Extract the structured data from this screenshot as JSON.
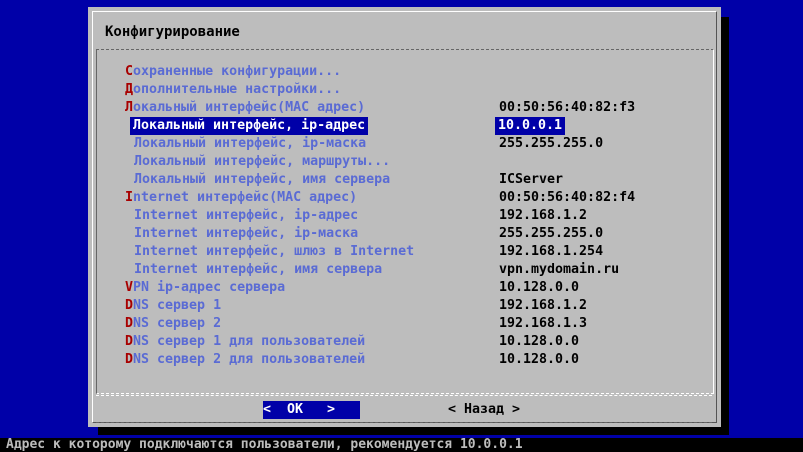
{
  "dialog": {
    "title": "Конфигурирование",
    "items": [
      {
        "hotkey": "С",
        "label": "охраненные конфигурации...",
        "value": "",
        "indent": false,
        "selected": false
      },
      {
        "hotkey": "Д",
        "label": "ополнительные настройки...",
        "value": "",
        "indent": false,
        "selected": false
      },
      {
        "hotkey": "Л",
        "label": "окальный интерфейс(MAC адрес)",
        "value": "00:50:56:40:82:f3",
        "indent": false,
        "selected": false
      },
      {
        "hotkey": "",
        "label": "Локальный интерфейс, ip-адрес",
        "value": "10.0.0.1",
        "indent": true,
        "selected": true
      },
      {
        "hotkey": "",
        "label": "Локальный интерфейс, ip-маска",
        "value": "255.255.255.0",
        "indent": true,
        "selected": false
      },
      {
        "hotkey": "",
        "label": "Локальный интерфейс, маршруты...",
        "value": "",
        "indent": true,
        "selected": false
      },
      {
        "hotkey": "",
        "label": "Локальный интерфейс, имя сервера",
        "value": "ICServer",
        "indent": true,
        "selected": false
      },
      {
        "hotkey": "I",
        "label": "nternet интерфейс(MAC адрес)",
        "value": "00:50:56:40:82:f4",
        "indent": false,
        "selected": false
      },
      {
        "hotkey": "",
        "label": "Internet интерфейс, ip-адрес",
        "value": "192.168.1.2",
        "indent": true,
        "selected": false
      },
      {
        "hotkey": "",
        "label": "Internet интерфейс, ip-маска",
        "value": "255.255.255.0",
        "indent": true,
        "selected": false
      },
      {
        "hotkey": "",
        "label": "Internet интерфейс, шлюз в Internet",
        "value": "192.168.1.254",
        "indent": true,
        "selected": false
      },
      {
        "hotkey": "",
        "label": "Internet интерфейс, имя сервера",
        "value": "vpn.mydomain.ru",
        "indent": true,
        "selected": false
      },
      {
        "hotkey": "V",
        "label": "PN ip-адрес сервера",
        "value": "10.128.0.0",
        "indent": false,
        "selected": false
      },
      {
        "hotkey": "D",
        "label": "NS сервер 1",
        "value": "192.168.1.2",
        "indent": false,
        "selected": false
      },
      {
        "hotkey": "D",
        "label": "NS сервер 2",
        "value": "192.168.1.3",
        "indent": false,
        "selected": false
      },
      {
        "hotkey": "D",
        "label": "NS сервер 1 для пользователей",
        "value": "10.128.0.0",
        "indent": false,
        "selected": false
      },
      {
        "hotkey": "D",
        "label": "NS сервер 2 для пользователей",
        "value": "10.128.0.0",
        "indent": false,
        "selected": false
      }
    ]
  },
  "buttons": {
    "ok": "<  OK   >",
    "back": "< Назад >"
  },
  "status_bar": "Адрес к которому подключаются пользователи, рекомендуется 10.0.0.1",
  "colors": {
    "background": "#0000a8",
    "dialog": "#bdbdbd",
    "hotkey": "#a80000",
    "label": "#5a6bd4",
    "selection": "#0000a8"
  }
}
